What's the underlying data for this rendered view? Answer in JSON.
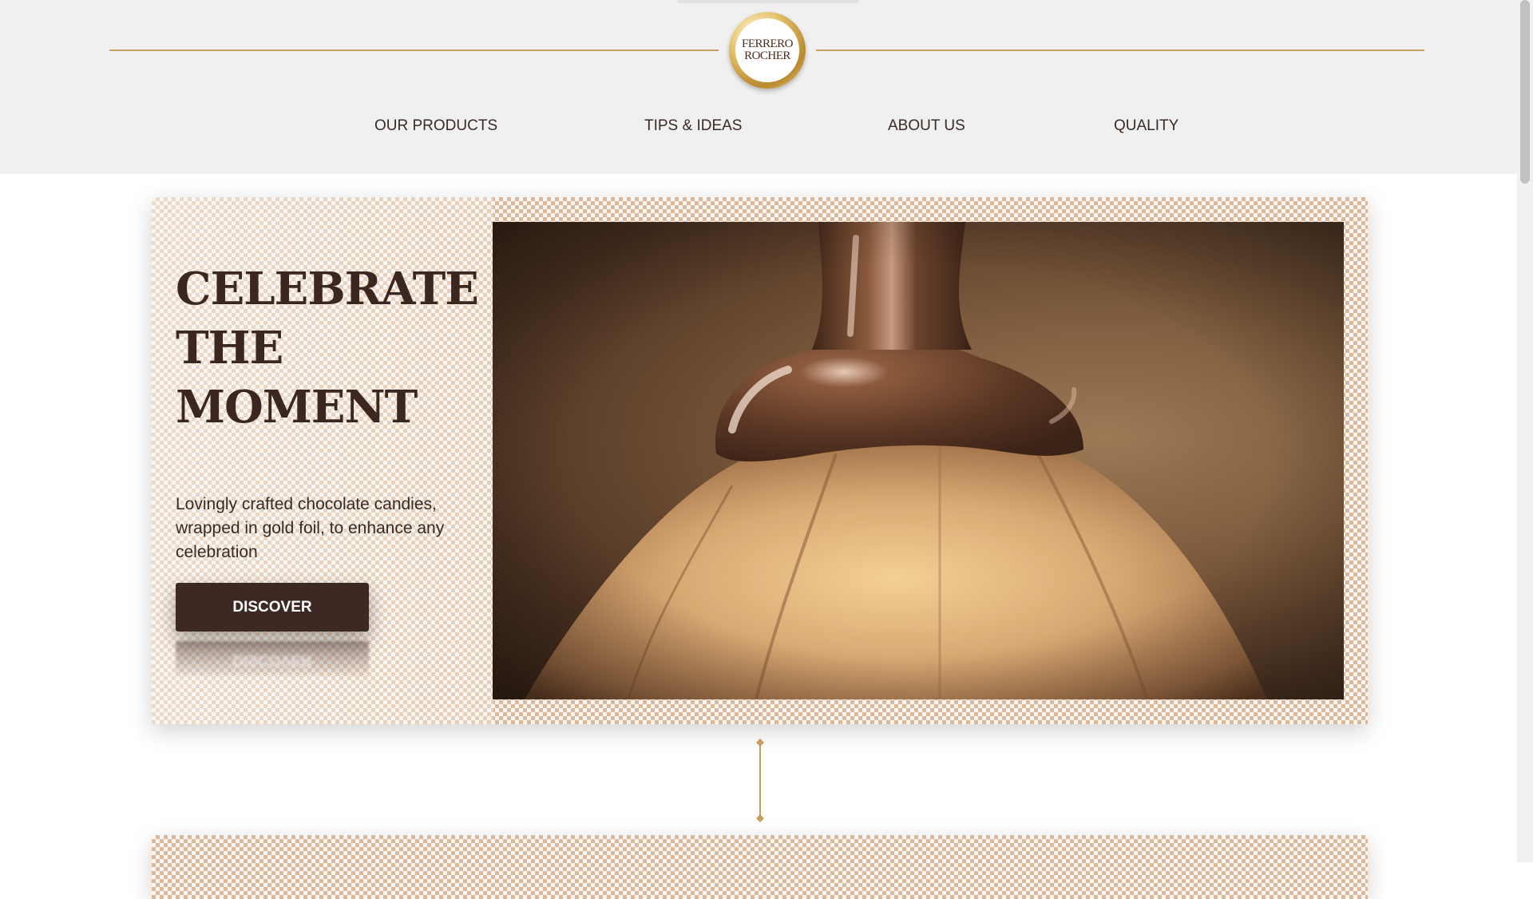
{
  "brand": {
    "logo_line1": "FERRERO",
    "logo_line2": "ROCHER"
  },
  "nav": {
    "items": [
      {
        "label": "OUR PRODUCTS"
      },
      {
        "label": "TIPS & IDEAS"
      },
      {
        "label": "ABOUT US"
      },
      {
        "label": "QUALITY"
      }
    ]
  },
  "hero": {
    "title": "CELEBRATE THE MOMENT",
    "description": "Lovingly crafted chocolate candies, wrapped in gold foil, to enhance any celebration",
    "button_label": "DISCOVER"
  },
  "colors": {
    "gold": "#c79f5c",
    "dark_brown": "#3e2823",
    "header_bg": "#f0f0f1"
  }
}
